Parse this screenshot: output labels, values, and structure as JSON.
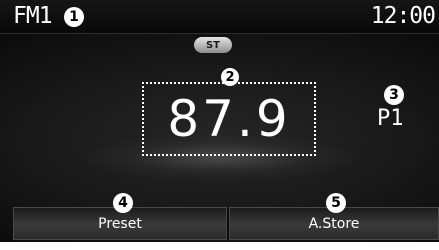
{
  "status": {
    "band": "FM1",
    "time": "12:00"
  },
  "radio": {
    "stereo_badge": "ST",
    "frequency": "87.9",
    "preset_number": "P1"
  },
  "buttons": {
    "preset_label": "Preset",
    "astore_label": "A.Store"
  },
  "callouts": [
    "1",
    "2",
    "3",
    "4",
    "5"
  ]
}
